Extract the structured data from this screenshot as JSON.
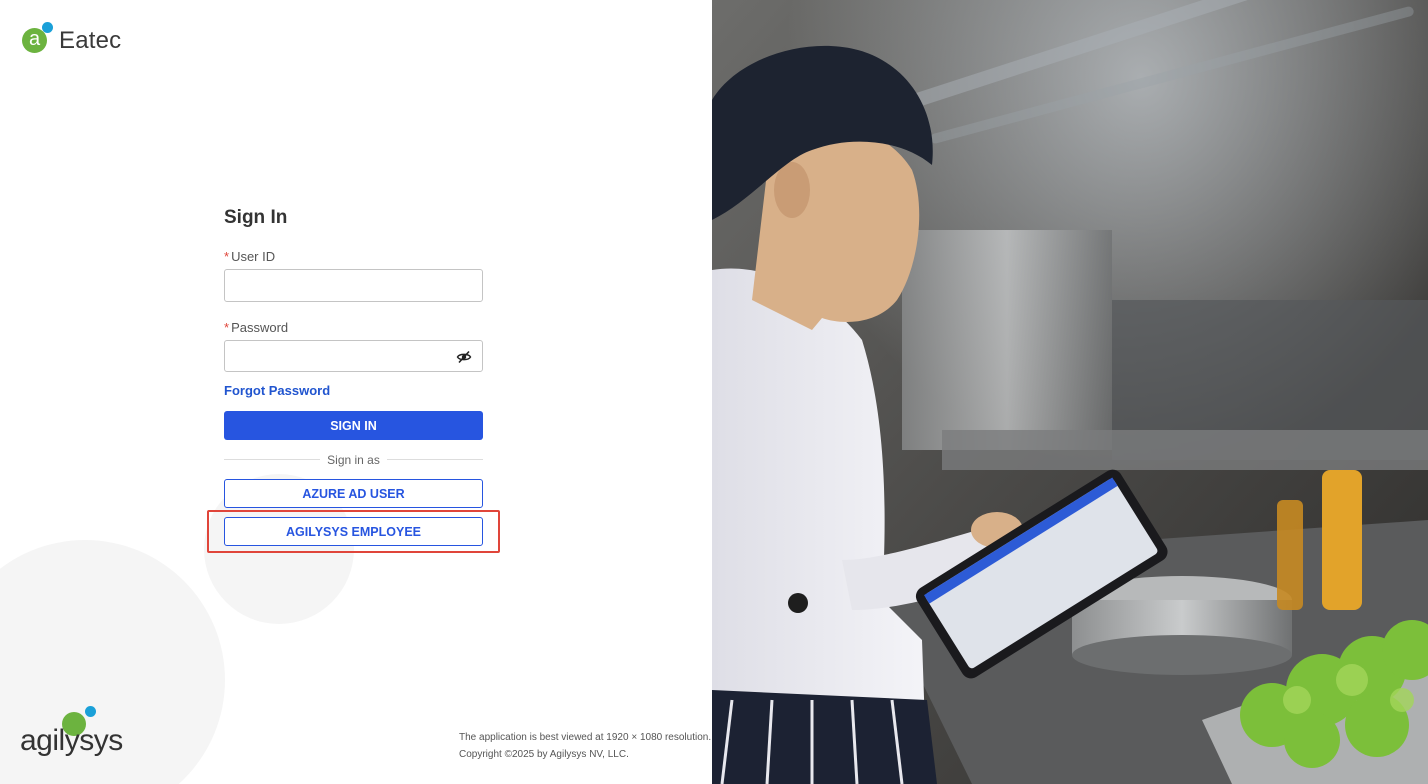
{
  "brand": {
    "icon_letter": "a",
    "name": "Eatec"
  },
  "signin": {
    "title": "Sign In",
    "required_marker": "*",
    "user_id_label": "User ID",
    "user_id_value": "",
    "password_label": "Password",
    "password_value": "",
    "forgot_password": "Forgot Password",
    "sign_in_button": "SIGN IN",
    "sign_in_as": "Sign in as",
    "azure_button": "AZURE AD USER",
    "agilysys_button": "AGILYSYS EMPLOYEE"
  },
  "footer": {
    "logo_text": "agilysys",
    "resolution_note": "The application is best viewed at 1920 × 1080 resolution.",
    "copyright": "Copyright ©2025 by Agilysys NV, LLC."
  },
  "icons": {
    "password_toggle": "eye-slash-icon"
  },
  "colors": {
    "primary": "#2755e0",
    "link": "#2155cf",
    "required": "#e0453a",
    "highlight": "#e0453a",
    "brand_green": "#6cb33f",
    "brand_blue": "#1aa0d8"
  }
}
